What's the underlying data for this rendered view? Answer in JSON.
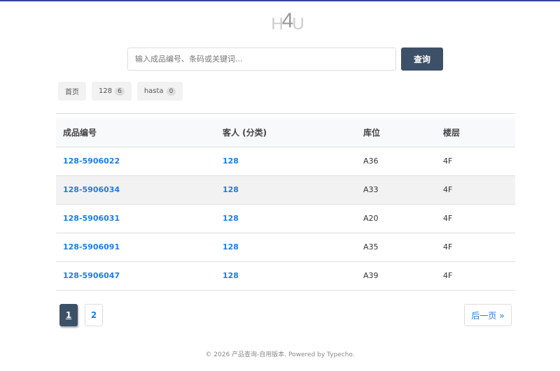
{
  "logo": {
    "text": "HD4U",
    "left": "H",
    "mid": "4",
    "right": "U"
  },
  "search": {
    "placeholder": "输入成品编号、条码或关键词...",
    "button": "查询"
  },
  "tags": [
    {
      "label": "首页"
    },
    {
      "label": "128",
      "count": "6"
    },
    {
      "label": "hasta",
      "count": "0"
    }
  ],
  "table": {
    "headers": [
      "成品编号",
      "客人 (分类)",
      "库位",
      "楼层"
    ],
    "rows": [
      [
        "128-5906022",
        "128",
        "A36",
        "4F"
      ],
      [
        "128-5906034",
        "128",
        "A33",
        "4F"
      ],
      [
        "128-5906031",
        "128",
        "A20",
        "4F"
      ],
      [
        "128-5906091",
        "128",
        "A35",
        "4F"
      ],
      [
        "128-5906047",
        "128",
        "A39",
        "4F"
      ]
    ]
  },
  "pagination": {
    "pages": [
      "1",
      "2"
    ],
    "current": "1",
    "next": "后一页 »"
  },
  "footer": "© 2026 产品查询-自用版本. Powered by Typecho.",
  "colors": {
    "accent": "#3c5068",
    "link": "#1e7de6",
    "top_border": "#34439a"
  }
}
